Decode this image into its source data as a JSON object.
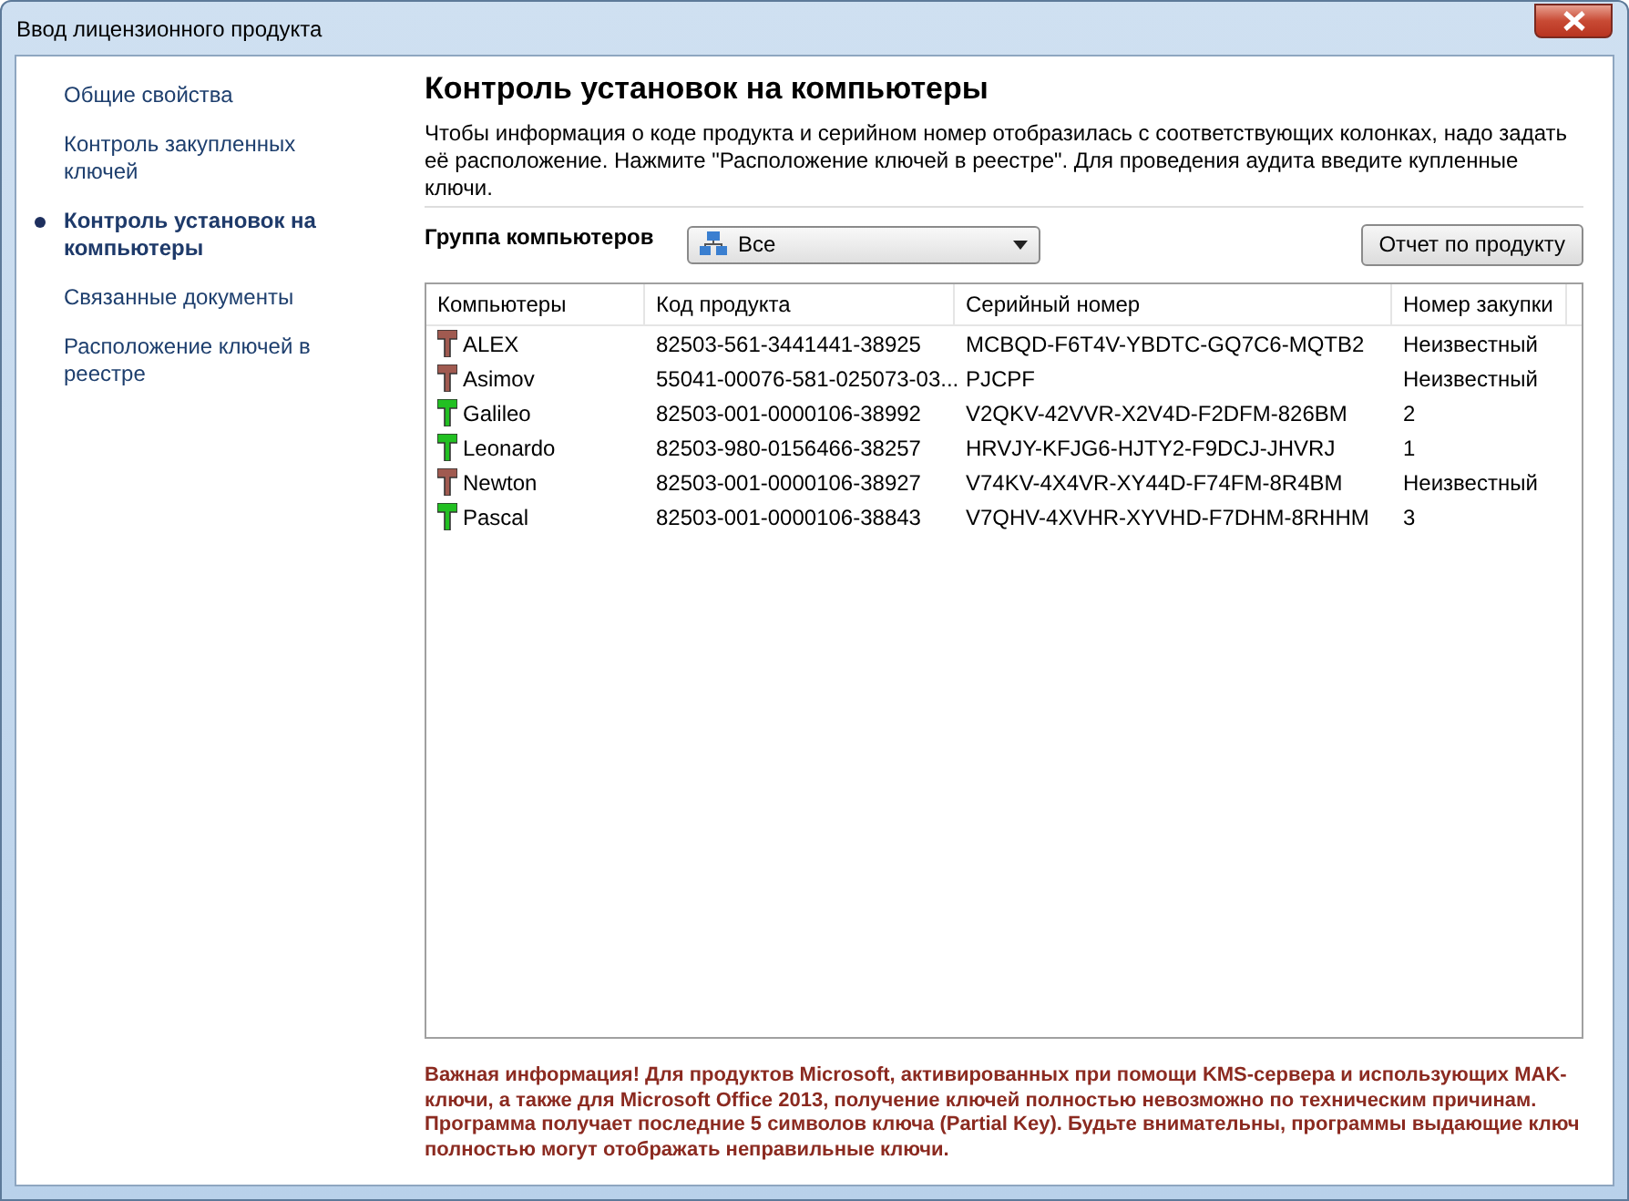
{
  "window": {
    "title": "Ввод лицензионного продукта"
  },
  "sidebar": {
    "items": [
      {
        "label": "Общие свойства",
        "selected": false
      },
      {
        "label": "Контроль закупленных ключей",
        "selected": false
      },
      {
        "label": "Контроль установок на компьютеры",
        "selected": true
      },
      {
        "label": "Связанные документы",
        "selected": false
      },
      {
        "label": "Расположение ключей в реестре",
        "selected": false
      }
    ]
  },
  "heading": "Контроль установок на компьютеры",
  "description": "Чтобы информация о коде продукта и серийном номер отобразилась с соответствующих колонках, надо задать её расположение. Нажмите \"Расположение ключей в реестре\". Для проведения аудита введите купленные ключи.",
  "group": {
    "label": "Группа компьютеров",
    "value": "Все"
  },
  "report_button": "Отчет по продукту",
  "table": {
    "columns": [
      "Компьютеры",
      "Код продукта",
      "Серийный номер",
      "Номер закупки"
    ],
    "rows": [
      {
        "color": "#a05a50",
        "cells": [
          "ALEX",
          "82503-561-3441441-38925",
          "MCBQD-F6T4V-YBDTC-GQ7C6-MQTB2",
          "Неизвестный"
        ]
      },
      {
        "color": "#a05a50",
        "cells": [
          "Asimov",
          "55041-00076-581-025073-03...",
          "PJCPF",
          "Неизвестный"
        ]
      },
      {
        "color": "#22c022",
        "cells": [
          "Galileo",
          "82503-001-0000106-38992",
          "V2QKV-42VVR-X2V4D-F2DFM-826BM",
          "2"
        ]
      },
      {
        "color": "#22c022",
        "cells": [
          "Leonardo",
          "82503-980-0156466-38257",
          "HRVJY-KFJG6-HJTY2-F9DCJ-JHVRJ",
          "1"
        ]
      },
      {
        "color": "#a05a50",
        "cells": [
          "Newton",
          "82503-001-0000106-38927",
          "V74KV-4X4VR-XY44D-F74FM-8R4BM",
          "Неизвестный"
        ]
      },
      {
        "color": "#22c022",
        "cells": [
          "Pascal",
          "82503-001-0000106-38843",
          "V7QHV-4XVHR-XYVHD-F7DHM-8RHHM",
          "3"
        ]
      }
    ]
  },
  "warning": "Важная информация! Для продуктов Microsoft, активированных при помощи KMS-сервера и использующих MAK-ключи, а также для Microsoft Office 2013, получение ключей полностью невозможно по техническим причинам. Программа получает последние 5 символов ключа (Partial Key). Будьте внимательны, программы выдающие ключ полностью могут отображать неправильные ключи."
}
